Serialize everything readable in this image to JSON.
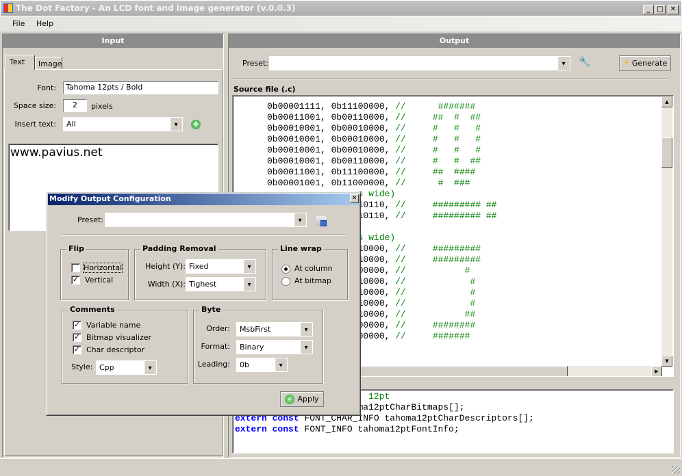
{
  "window": {
    "title": "The Dot Factory - An LCD font and image generator (v.0.0.3)",
    "minimize": "_",
    "maximize": "□",
    "close": "✕"
  },
  "menu": [
    "File",
    "Help"
  ],
  "input": {
    "header": "Input",
    "tabs": [
      "Text",
      "Image"
    ],
    "font_label": "Font:",
    "font_value": "Tahoma 12pts / Bold",
    "space_label": "Space size:",
    "space_value": "2",
    "space_unit": "pixels",
    "insert_label": "Insert text:",
    "insert_value": "All",
    "text": "www.pavius.net"
  },
  "output": {
    "header": "Output",
    "preset_label": "Preset:",
    "preset_value": "",
    "generate_label": "Generate",
    "source_label": "Source file (.c)",
    "source_lines": [
      {
        "code": "0b00001111, 0b11100000, ",
        "comment": "//      #######"
      },
      {
        "code": "0b00011001, 0b00110000, ",
        "comment": "//     ##  #  ##"
      },
      {
        "code": "0b00010001, 0b00010000, ",
        "comment": "//     #   #   #"
      },
      {
        "code": "0b00010001, 0b00010000, ",
        "comment": "//     #   #   #"
      },
      {
        "code": "0b00010001, 0b00010000, ",
        "comment": "//     #   #   #"
      },
      {
        "code": "0b00010001, 0b00110000, ",
        "comment": "//     #   #  ##"
      },
      {
        "code": "0b00011001, 0b11100000, ",
        "comment": "//     ##  ####"
      },
      {
        "code": "0b00001001, 0b11000000, ",
        "comment": "//      #  ###"
      },
      {
        "code": "",
        "comment": "s wide)"
      },
      {
        "code": "10110, ",
        "comment": "//     ######### ##"
      },
      {
        "code": "10110, ",
        "comment": "//     ######### ##"
      },
      {
        "code": "",
        "comment": ""
      },
      {
        "code": "",
        "comment": "s wide)"
      },
      {
        "code": "10000, ",
        "comment": "//     #########"
      },
      {
        "code": "10000, ",
        "comment": "//     #########"
      },
      {
        "code": "00000, ",
        "comment": "//           #"
      },
      {
        "code": "10000, ",
        "comment": "//            #"
      },
      {
        "code": "10000, ",
        "comment": "//            #"
      },
      {
        "code": "10000, ",
        "comment": "//            #"
      },
      {
        "code": "10000, ",
        "comment": "//           ##"
      },
      {
        "code": "00000, ",
        "comment": "//     ########"
      },
      {
        "code": "00000, ",
        "comment": "//     #######"
      }
    ],
    "header_lines": [
      {
        "kw": "",
        "text": "",
        "comment": "12pt"
      },
      {
        "kw": "",
        "text": "oma12ptCharBitmaps[];",
        "comment": ""
      },
      {
        "kw": "extern const",
        "text": " FONT_CHAR_INFO tahoma12ptCharDescriptors[];",
        "comment": ""
      },
      {
        "kw": "extern const",
        "text": " FONT_INFO tahoma12ptFontInfo;",
        "comment": ""
      }
    ]
  },
  "dialog": {
    "title": "Modify Output Configuration",
    "preset_label": "Preset:",
    "preset_value": "",
    "flip": {
      "title": "Flip",
      "horizontal": "Horizontal",
      "horizontal_checked": false,
      "vertical": "Vertical",
      "vertical_checked": true
    },
    "padding": {
      "title": "Padding Removal",
      "height_label": "Height (Y):",
      "height_value": "Fixed",
      "width_label": "Width (X):",
      "width_value": "Tighest"
    },
    "linewrap": {
      "title": "Line wrap",
      "at_column": "At column",
      "at_bitmap": "At bitmap",
      "selected": "At column"
    },
    "comments": {
      "title": "Comments",
      "variable_name": "Variable name",
      "bitmap_visualizer": "Bitmap visualizer",
      "char_descriptor": "Char descriptor",
      "style_label": "Style:",
      "style_value": "Cpp"
    },
    "byte": {
      "title": "Byte",
      "order_label": "Order:",
      "order_value": "MsbFirst",
      "format_label": "Format:",
      "format_value": "Binary",
      "leading_label": "Leading:",
      "leading_value": "0b"
    },
    "apply_label": "Apply"
  },
  "colors": {
    "comment": "#008000",
    "keyword": "#0000ff",
    "dialog_title_start": "#0a246a",
    "dialog_title_end": "#a6caf0"
  }
}
